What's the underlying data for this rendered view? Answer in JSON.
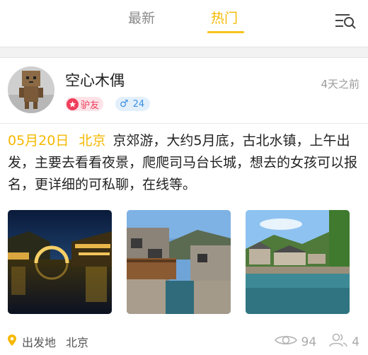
{
  "tabs": [
    {
      "label": "最新",
      "active": false
    },
    {
      "label": "热门",
      "active": true
    }
  ],
  "colors": {
    "accent": "#f5b800",
    "role": "#ef3e5c",
    "age": "#3d8fe0"
  },
  "post": {
    "user": {
      "name": "空心木偶",
      "role_badge": "驴友",
      "role_level": "1",
      "gender": "♂",
      "age": "24"
    },
    "time_ago": "4天之前",
    "date": "05月20日",
    "city": "北京",
    "text": "京郊游，大约5月底，古北水镇，上午出发，主要去看看夜景，爬爬司马台长城，想去的女孩可以报名，更详细的可私聊，在线等。",
    "photos": [
      "night-water-town-bridge",
      "canal-between-old-houses",
      "river-town-with-hills"
    ],
    "departure_label": "出发地",
    "departure_city": "北京",
    "views": "94",
    "participants": "4"
  }
}
